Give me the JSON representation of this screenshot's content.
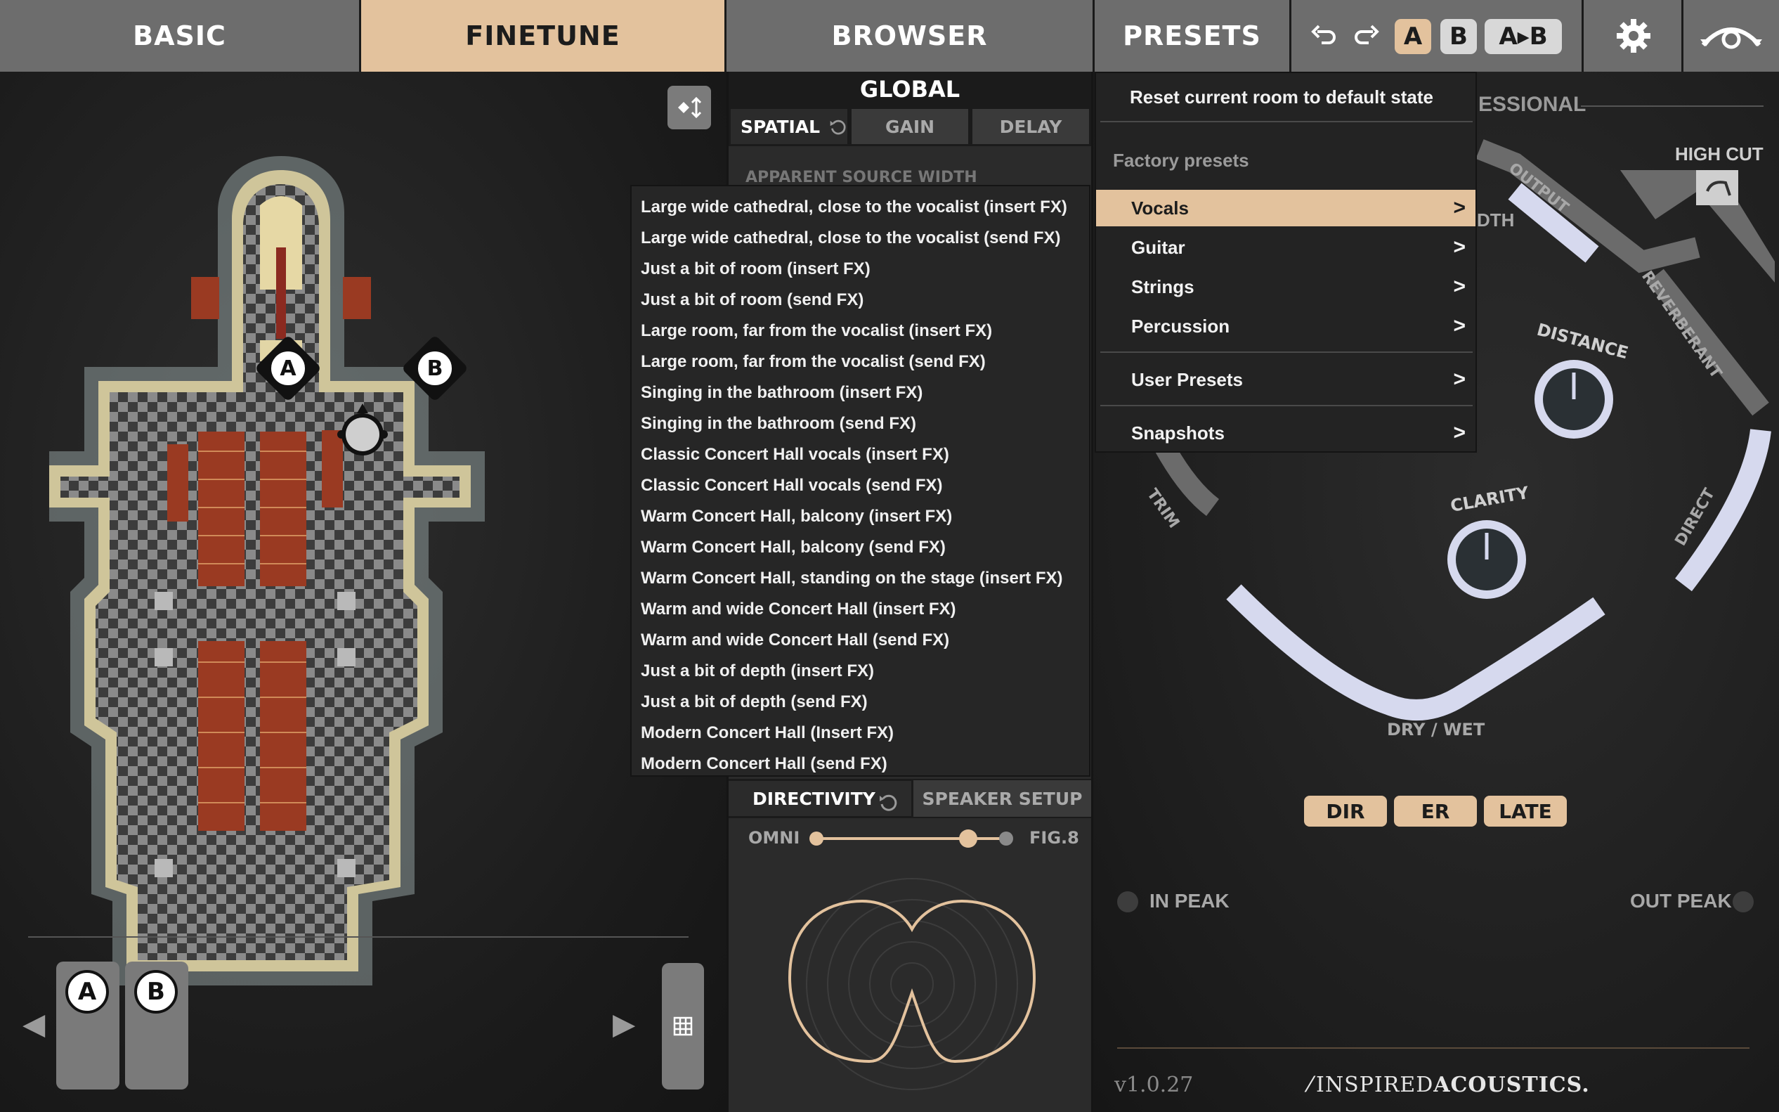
{
  "topbar": {
    "tabs": [
      "BASIC",
      "FINETUNE",
      "BROWSER",
      "PRESETS"
    ],
    "undo_icon": "undo-icon",
    "redo_icon": "redo-icon",
    "ab": {
      "a": "A",
      "b": "B",
      "copy": "A▸B"
    },
    "settings_icon": "gear-icon",
    "ia_icon": "inspired-acoustics-icon"
  },
  "room": {
    "mic_a": "A",
    "mic_b": "B",
    "view_toggle_icon": "view-toggle-icon",
    "slots": [
      "A",
      "B"
    ],
    "grid_icon": "grid-icon"
  },
  "middle": {
    "global_title": "GLOBAL",
    "tabs": [
      "SPATIAL",
      "GAIN",
      "DELAY"
    ],
    "partial_label": "APPARENT SOURCE WIDTH",
    "directivity_tab": "DIRECTIVITY",
    "speaker_setup_tab": "SPEAKER SETUP",
    "omni_label": "OMNI",
    "fig8_label": "FIG.8",
    "directivity_value": 0.84
  },
  "preset_list": [
    "Large wide cathedral, close to the vocalist (insert FX)",
    "Large wide cathedral, close to the vocalist (send FX)",
    "Just a bit of room (insert FX)",
    "Just a bit of room (send FX)",
    "Large room, far from the vocalist (insert FX)",
    "Large room, far from the vocalist (send FX)",
    "Singing in the bathroom (insert FX)",
    "Singing in the bathroom (send FX)",
    "Classic Concert Hall vocals (insert FX)",
    "Classic Concert Hall vocals (send FX)",
    "Warm Concert Hall, balcony (insert FX)",
    "Warm Concert Hall, balcony (send FX)",
    "Warm Concert Hall, standing on the stage (insert FX)",
    "Warm and wide Concert Hall (insert FX)",
    "Warm and wide Concert Hall (send FX)",
    "Just a bit of depth (insert FX)",
    "Just a bit of depth (send FX)",
    "Modern Concert Hall (Insert FX)",
    "Modern Concert Hall (send FX)"
  ],
  "preset_menu": {
    "reset": "Reset current room to default state",
    "factory_header": "Factory presets",
    "categories": [
      "Vocals",
      "Guitar",
      "Strings",
      "Percussion"
    ],
    "user_presets": "User Presets",
    "snapshots": "Snapshots",
    "selected": "Vocals"
  },
  "right": {
    "partial_title": "ESSIONAL",
    "partial_width": "DTH",
    "high_cut": "HIGH CUT",
    "output": "OUTPUT",
    "reverberant": "REVERBERANT",
    "distance": "DISTANCE",
    "clarity": "CLARITY",
    "trim": "TRIM",
    "direct": "DIRECT",
    "dry_wet": "DRY / WET",
    "buttons": [
      "DIR",
      "ER",
      "LATE"
    ],
    "in_peak": "IN PEAK",
    "out_peak": "OUT PEAK",
    "version": "v1.0.27",
    "brand_thin": "INSPIRED",
    "brand_bold": "ACOUSTICS.",
    "accent": "#e3c29d",
    "arc_color": "#d6d9ee"
  }
}
